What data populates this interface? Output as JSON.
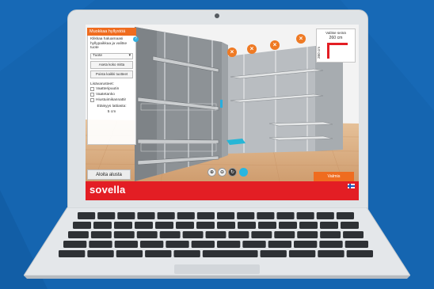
{
  "colors": {
    "background": "#1565b0",
    "accent": "#ef6c1f",
    "brand_bar": "#e31e24",
    "help": "#34b0e0"
  },
  "panel": {
    "header": "Muokkaa hyllystöä",
    "help_icon": "?",
    "instruction": "Klikkaa haluamaasi hyllypaikkaa ja valitse tuote",
    "product_select": "Tuote",
    "button_set_full_height": "Aseta koko mitta",
    "button_remove_all_shelves": "Poista kaikki tuotteet",
    "accessories_title": "Lisävarusteet:",
    "accessories": [
      "Vaatteripuutin",
      "Vaatetanko",
      "Hiustuimikannattir"
    ],
    "distance_label": "Etäisyys lattiasta:",
    "distance_value": "5 cm"
  },
  "wall_selector": {
    "title": "Valitse seinä",
    "width_value": "260 cm",
    "height_value": "260 cm"
  },
  "controls": {
    "zoom_in": "zoom-in-icon",
    "zoom_out": "zoom-out-icon",
    "rotate": "rotate-icon",
    "active": "cube-icon"
  },
  "buttons": {
    "start_over": "Aloita alusta",
    "done": "Valmis"
  },
  "brand": {
    "logo": "sovella"
  },
  "remove_markers": [
    "×",
    "×",
    "×",
    "×"
  ]
}
